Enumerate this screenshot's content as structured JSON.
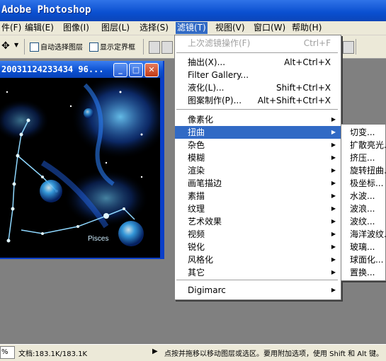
{
  "app": {
    "title": "Adobe Photoshop"
  },
  "menubar": [
    "件(F)",
    "编辑(E)",
    "图像(I)",
    "图层(L)",
    "选择(S)",
    "滤镜(T)",
    "视图(V)",
    "窗口(W)",
    "帮助(H)"
  ],
  "options": {
    "auto_select_layer": "自动选择图层",
    "show_bounding_box": "显示定界框"
  },
  "document": {
    "title": "20031124233434 96...",
    "canvas_text": "Pisces"
  },
  "filter_menu": {
    "last_filter": "上次滤镜操作(F)",
    "last_filter_shortcut": "Ctrl+F",
    "extract": "抽出(X)...",
    "extract_shortcut": "Alt+Ctrl+X",
    "filter_gallery": "Filter Gallery...",
    "liquify": "液化(L)...",
    "liquify_shortcut": "Shift+Ctrl+X",
    "pattern_maker": "图案制作(P)...",
    "pattern_maker_shortcut": "Alt+Shift+Ctrl+X",
    "groups": [
      "像素化",
      "扭曲",
      "杂色",
      "模糊",
      "渲染",
      "画笔描边",
      "素描",
      "纹理",
      "艺术效果",
      "视频",
      "锐化",
      "风格化",
      "其它"
    ],
    "digimarc": "Digimarc"
  },
  "distort_menu": [
    "切变...",
    "扩散亮光...",
    "挤压...",
    "旋转扭曲...",
    "极坐标...",
    "水波...",
    "波浪...",
    "波纹...",
    "海洋波纹...",
    "玻璃...",
    "球面化...",
    "置换..."
  ],
  "status": {
    "zoom": "%",
    "doc_info": "文档:183.1K/183.1K",
    "hint": "点按并拖移以移动图层或选区。要用附加选项，使用 Shift 和 Alt 键。"
  }
}
